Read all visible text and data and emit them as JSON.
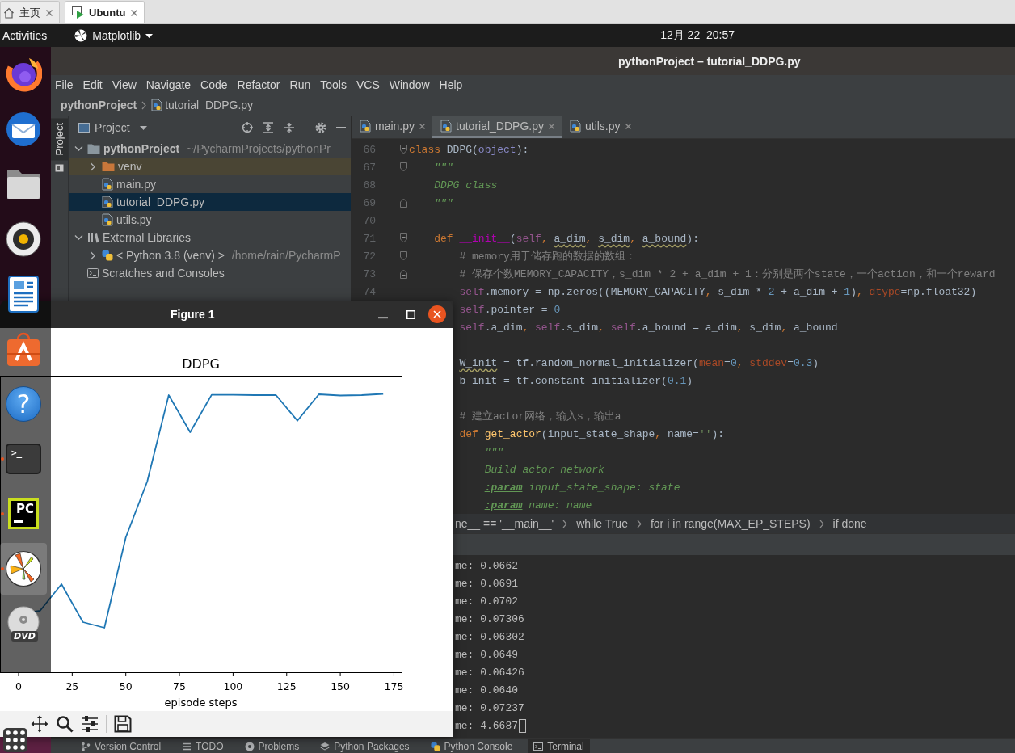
{
  "browser_tabs": [
    {
      "label": "主页",
      "kind": "home",
      "selected": false
    },
    {
      "label": "Ubuntu",
      "kind": "vm",
      "selected": true
    }
  ],
  "top_bar": {
    "activities": "Activities",
    "app_menu": "Matplotlib",
    "clock": "12月 22  20:57"
  },
  "dock": {
    "items": [
      {
        "kind": "browser",
        "running": false,
        "focused": false
      },
      {
        "kind": "mail",
        "running": false,
        "focused": false
      },
      {
        "kind": "files",
        "running": false,
        "focused": false
      },
      {
        "kind": "music",
        "running": false,
        "focused": false
      },
      {
        "kind": "writer",
        "running": false,
        "focused": false
      },
      {
        "kind": "store",
        "running": false,
        "focused": false
      },
      {
        "kind": "help",
        "glyph": "?",
        "running": false,
        "focused": false
      },
      {
        "kind": "terminal",
        "glyph": ">_",
        "running": true,
        "focused": false
      },
      {
        "kind": "ide",
        "glyph": "PC",
        "running": true,
        "focused": false
      },
      {
        "kind": "plot",
        "running": true,
        "focused": true
      },
      {
        "kind": "disc",
        "glyph": "DVD",
        "running": false,
        "focused": false
      }
    ]
  },
  "ide": {
    "title": "pythonProject – tutorial_DDPG.py",
    "menu": [
      {
        "key": "F",
        "rest": "ile"
      },
      {
        "key": "E",
        "rest": "dit"
      },
      {
        "key": "V",
        "rest": "iew"
      },
      {
        "key": "N",
        "rest": "avigate"
      },
      {
        "key": "C",
        "rest": "ode"
      },
      {
        "key": "R",
        "rest": "efactor"
      },
      {
        "lead": "R",
        "key": "u",
        "rest": "n"
      },
      {
        "key": "T",
        "rest": "ools"
      },
      {
        "lead": "VC",
        "key": "S"
      },
      {
        "key": "W",
        "rest": "indow"
      },
      {
        "key": "H",
        "rest": "elp"
      }
    ],
    "nav_bar": {
      "project": "pythonProject",
      "file": "tutorial_DDPG.py"
    },
    "tool_strip": [
      {
        "label": "Project",
        "selected": true
      }
    ],
    "project_panel": {
      "title": "Project",
      "tree": [
        {
          "label": "pythonProject",
          "kind": "project-folder",
          "hint": "~/PycharmProjects/pythonPr",
          "expanded": true,
          "selected": false,
          "children": [
            {
              "label": "venv",
              "kind": "excluded-folder",
              "expanded": false,
              "selected": false
            },
            {
              "label": "main.py",
              "kind": "python-file",
              "selected": false
            },
            {
              "label": "tutorial_DDPG.py",
              "kind": "python-file",
              "selected": true
            },
            {
              "label": "utils.py",
              "kind": "python-file",
              "selected": false
            }
          ]
        },
        {
          "label": "External Libraries",
          "kind": "libraries",
          "expanded": true,
          "selected": false,
          "children": [
            {
              "label": "< Python 3.8 (venv) >",
              "kind": "python-sdk",
              "hint": "/home/rain/PycharmP",
              "expanded": false,
              "selected": false
            }
          ]
        },
        {
          "label": "Scratches and Consoles",
          "kind": "scratches",
          "selected": false
        }
      ]
    },
    "editor_tabs": [
      {
        "label": "main.py",
        "selected": false
      },
      {
        "label": "tutorial_DDPG.py",
        "selected": true
      },
      {
        "label": "utils.py",
        "selected": false
      }
    ],
    "code_lines": [
      {
        "kind": "code",
        "number": "66",
        "fold": {
          "kind": "start"
        },
        "tokens": [
          {
            "text": "class",
            "kind": "keyword",
            "warn": false
          },
          {
            "text": " DDPG(",
            "kind": "plain",
            "warn": false
          },
          {
            "text": "object",
            "kind": "builtin",
            "warn": false
          },
          {
            "text": "):",
            "kind": "plain",
            "warn": false
          }
        ]
      },
      {
        "kind": "code",
        "number": "67",
        "fold": {
          "kind": "start"
        },
        "tokens": [
          {
            "text": "    \"\"\"",
            "kind": "doc",
            "warn": false
          }
        ]
      },
      {
        "kind": "code",
        "number": "68",
        "tokens": [
          {
            "text": "    DDPG class",
            "kind": "doc",
            "warn": false
          }
        ]
      },
      {
        "kind": "code",
        "number": "69",
        "fold": {
          "kind": "end"
        },
        "tokens": [
          {
            "text": "    \"\"\"",
            "kind": "doc",
            "warn": false
          }
        ]
      },
      {
        "kind": "blank",
        "number": "70"
      },
      {
        "kind": "code",
        "number": "71",
        "fold": {
          "kind": "start"
        },
        "tokens": [
          {
            "text": "    def ",
            "kind": "keyword",
            "warn": false
          },
          {
            "text": "__init__",
            "kind": "magic",
            "warn": false
          },
          {
            "text": "(",
            "kind": "plain",
            "warn": false
          },
          {
            "text": "self",
            "kind": "self",
            "warn": false
          },
          {
            "text": ", ",
            "kind": "punct",
            "warn": false
          },
          {
            "text": "a_dim",
            "kind": "plain",
            "warn": true
          },
          {
            "text": ", ",
            "kind": "punct",
            "warn": false
          },
          {
            "text": "s_dim",
            "kind": "plain",
            "warn": true
          },
          {
            "text": ", ",
            "kind": "punct",
            "warn": false
          },
          {
            "text": "a_bound",
            "kind": "plain",
            "warn": true
          },
          {
            "text": "):",
            "kind": "plain",
            "warn": false
          }
        ]
      },
      {
        "kind": "code",
        "number": "72",
        "fold": {
          "kind": "start"
        },
        "tokens": [
          {
            "text": "        # memory用于储存跑的数据的数组：",
            "kind": "comment",
            "warn": false
          }
        ]
      },
      {
        "kind": "code",
        "number": "73",
        "fold": {
          "kind": "end"
        },
        "tokens": [
          {
            "text": "        # 保存个数MEMORY_CAPACITY，s_dim * 2 + a_dim + 1：分别是两个state，一个action，和一个reward",
            "kind": "comment",
            "warn": false
          }
        ]
      },
      {
        "kind": "code",
        "number": "74",
        "tokens": [
          {
            "text": "        self",
            "kind": "self",
            "warn": false
          },
          {
            "text": ".memory = np.zeros((MEMORY_CAPACITY",
            "kind": "plain",
            "warn": false
          },
          {
            "text": ", ",
            "kind": "punct",
            "warn": false
          },
          {
            "text": "s_dim * ",
            "kind": "plain",
            "warn": false
          },
          {
            "text": "2",
            "kind": "number",
            "warn": false
          },
          {
            "text": " + a_dim + ",
            "kind": "plain",
            "warn": false
          },
          {
            "text": "1",
            "kind": "number",
            "warn": false
          },
          {
            "text": ")",
            "kind": "plain",
            "warn": false
          },
          {
            "text": ", ",
            "kind": "punct",
            "warn": false
          },
          {
            "text": "dtype",
            "kind": "kwarg",
            "warn": false
          },
          {
            "text": "=np.float32)",
            "kind": "plain",
            "warn": false
          }
        ]
      },
      {
        "kind": "code",
        "tokens": [
          {
            "text": "        self",
            "kind": "self",
            "warn": false
          },
          {
            "text": ".pointer = ",
            "kind": "plain",
            "warn": false
          },
          {
            "text": "0",
            "kind": "number",
            "warn": false
          }
        ]
      },
      {
        "kind": "code",
        "tokens": [
          {
            "text": "        self",
            "kind": "self",
            "warn": false
          },
          {
            "text": ".a_dim",
            "kind": "plain",
            "warn": false
          },
          {
            "text": ", ",
            "kind": "punct",
            "warn": false
          },
          {
            "text": "self",
            "kind": "self",
            "warn": false
          },
          {
            "text": ".s_dim",
            "kind": "plain",
            "warn": false
          },
          {
            "text": ", ",
            "kind": "punct",
            "warn": false
          },
          {
            "text": "self",
            "kind": "self",
            "warn": false
          },
          {
            "text": ".a_bound = a_dim",
            "kind": "plain",
            "warn": false
          },
          {
            "text": ", ",
            "kind": "punct",
            "warn": false
          },
          {
            "text": "s_dim",
            "kind": "plain",
            "warn": false
          },
          {
            "text": ", ",
            "kind": "punct",
            "warn": false
          },
          {
            "text": "a_bound",
            "kind": "plain",
            "warn": false
          }
        ]
      },
      {
        "kind": "blank"
      },
      {
        "kind": "code",
        "tokens": [
          {
            "text": "        W_init",
            "kind": "plain",
            "warn": true
          },
          {
            "text": " = tf.random_normal_initializer(",
            "kind": "plain",
            "warn": false
          },
          {
            "text": "mean",
            "kind": "kwarg",
            "warn": false
          },
          {
            "text": "=",
            "kind": "plain",
            "warn": false
          },
          {
            "text": "0",
            "kind": "number",
            "warn": false
          },
          {
            "text": ", ",
            "kind": "punct",
            "warn": false
          },
          {
            "text": "stddev",
            "kind": "kwarg",
            "warn": false
          },
          {
            "text": "=",
            "kind": "plain",
            "warn": false
          },
          {
            "text": "0.3",
            "kind": "number",
            "warn": false
          },
          {
            "text": ")",
            "kind": "plain",
            "warn": false
          }
        ]
      },
      {
        "kind": "code",
        "tokens": [
          {
            "text": "        b_init = tf.constant_initializer(",
            "kind": "plain",
            "warn": false
          },
          {
            "text": "0.1",
            "kind": "number",
            "warn": false
          },
          {
            "text": ")",
            "kind": "plain",
            "warn": false
          }
        ]
      },
      {
        "kind": "blank"
      },
      {
        "kind": "code",
        "tokens": [
          {
            "text": "        # 建立actor网络，输入s，输出a",
            "kind": "comment",
            "warn": false
          }
        ]
      },
      {
        "kind": "code",
        "tokens": [
          {
            "text": "        def ",
            "kind": "keyword",
            "warn": false
          },
          {
            "text": "get_actor",
            "kind": "func",
            "warn": false
          },
          {
            "text": "(input_state_shape",
            "kind": "plain",
            "warn": false
          },
          {
            "text": ", ",
            "kind": "punct",
            "warn": false
          },
          {
            "text": "name=",
            "kind": "plain",
            "warn": false
          },
          {
            "text": "''",
            "kind": "string",
            "warn": false
          },
          {
            "text": "):",
            "kind": "plain",
            "warn": false
          }
        ]
      },
      {
        "kind": "code",
        "tokens": [
          {
            "text": "            \"\"\"",
            "kind": "doc",
            "warn": false
          }
        ]
      },
      {
        "kind": "code",
        "tokens": [
          {
            "text": "            Build actor network",
            "kind": "doc",
            "warn": false
          }
        ]
      },
      {
        "kind": "code",
        "tokens": [
          {
            "text": "            :param",
            "kind": "doctag",
            "warn": false
          },
          {
            "text": " input_state_shape: state",
            "kind": "doc",
            "warn": false
          }
        ]
      },
      {
        "kind": "code",
        "tokens": [
          {
            "text": "            :param",
            "kind": "doctag",
            "warn": false
          },
          {
            "text": " name: name",
            "kind": "doc",
            "warn": false
          }
        ]
      }
    ],
    "breadcrumbs": [
      "ne__ == '__main__'",
      "while True",
      "for i in range(MAX_EP_STEPS)",
      "if done"
    ],
    "terminal_lines": [
      {
        "text": "me: 0.0662",
        "cursor": false
      },
      {
        "text": "me: 0.0691",
        "cursor": false
      },
      {
        "text": "me: 0.0702",
        "cursor": false
      },
      {
        "text": "me: 0.07306",
        "cursor": false
      },
      {
        "text": "me: 0.06302",
        "cursor": false
      },
      {
        "text": "me: 0.0649",
        "cursor": false
      },
      {
        "text": "me: 0.06426",
        "cursor": false
      },
      {
        "text": "me: 0.0640",
        "cursor": false
      },
      {
        "text": "me: 0.07237",
        "cursor": false
      },
      {
        "text": "me: 4.6687",
        "cursor": true
      }
    ],
    "tool_windows": [
      {
        "label": "Version Control",
        "kind": "vcs",
        "selected": false
      },
      {
        "label": "TODO",
        "kind": "todo",
        "selected": false
      },
      {
        "label": "Problems",
        "kind": "problems",
        "selected": false
      },
      {
        "label": "Python Packages",
        "kind": "packages",
        "selected": false
      },
      {
        "label": "Python Console",
        "kind": "console",
        "selected": false
      },
      {
        "label": "Terminal",
        "kind": "terminal",
        "selected": true
      }
    ]
  },
  "figure": {
    "title": "Figure 1",
    "plot_title": "DDPG",
    "xlabel": "episode steps",
    "xtick_labels": [
      "0",
      "25",
      "50",
      "75",
      "100",
      "125",
      "150",
      "175"
    ]
  }
}
